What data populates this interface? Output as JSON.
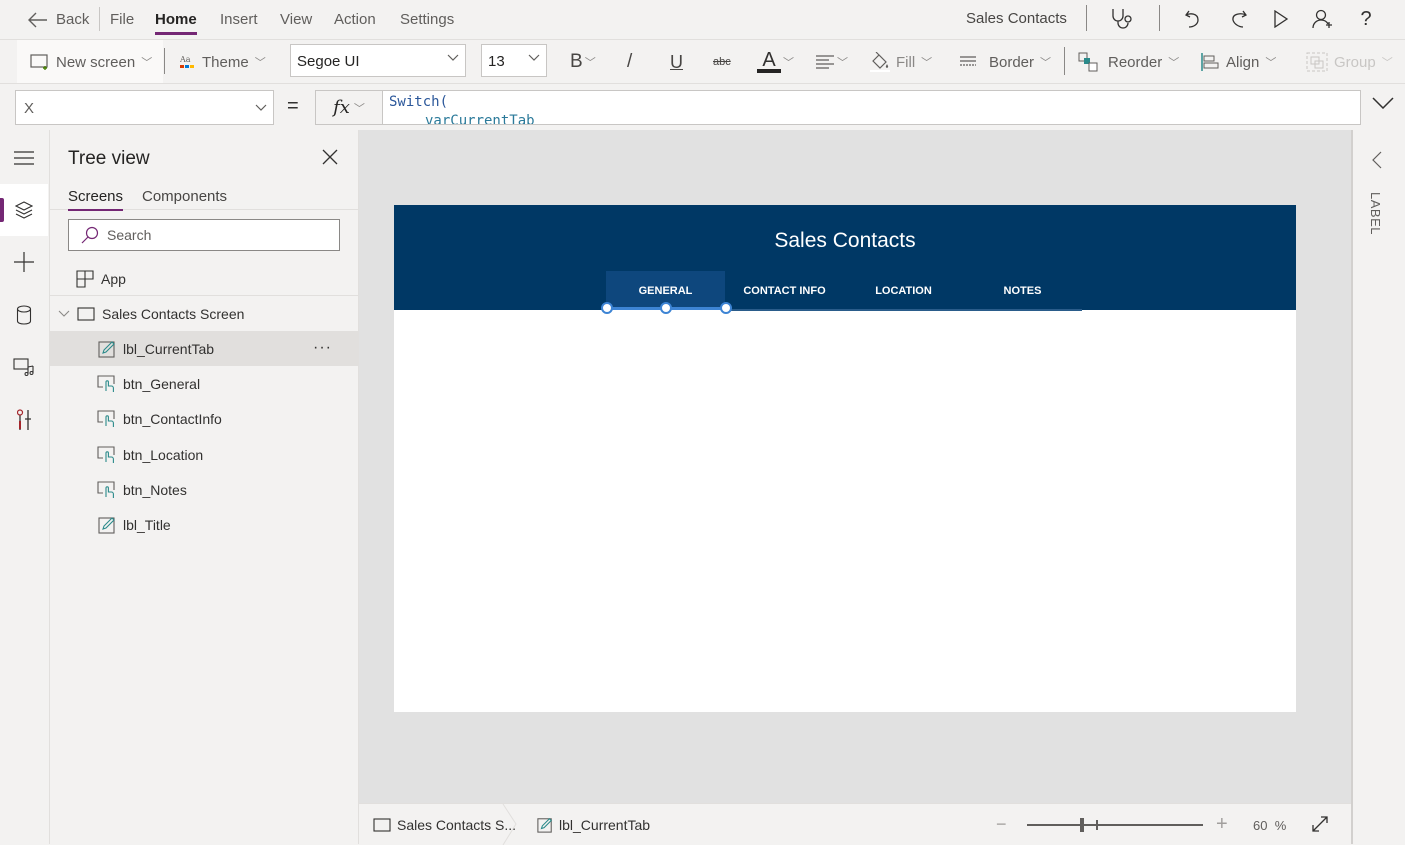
{
  "menubar": {
    "back_label": "Back",
    "items": [
      {
        "label": "File",
        "active": false
      },
      {
        "label": "Home",
        "active": true
      },
      {
        "label": "Insert",
        "active": false
      },
      {
        "label": "View",
        "active": false
      },
      {
        "label": "Action",
        "active": false
      },
      {
        "label": "Settings",
        "active": false
      }
    ],
    "app_name": "Sales Contacts",
    "icons": [
      "app-checker-icon",
      "undo-icon",
      "redo-icon",
      "play-icon",
      "share-user-icon",
      "help-icon"
    ]
  },
  "ribbon": {
    "new_screen": "New screen",
    "theme": "Theme",
    "font": "Segoe UI",
    "font_size": "13",
    "bold": "B",
    "italic": "/",
    "underline": "U",
    "strike": "abc",
    "font_color": "A",
    "fill": "Fill",
    "border": "Border",
    "reorder": "Reorder",
    "align": "Align",
    "group": "Group"
  },
  "formulabar": {
    "property": "X",
    "equals": "=",
    "fx": "fx",
    "formula_line1": "Switch(",
    "formula_line2": "varCurrentTab"
  },
  "tree": {
    "title": "Tree view",
    "tabs": [
      {
        "label": "Screens",
        "active": true
      },
      {
        "label": "Components",
        "active": false
      }
    ],
    "search_placeholder": "Search",
    "app_label": "App",
    "screen_label": "Sales Contacts Screen",
    "controls": [
      {
        "name": "lbl_CurrentTab",
        "type": "label",
        "selected": true
      },
      {
        "name": "btn_General",
        "type": "button",
        "selected": false
      },
      {
        "name": "btn_ContactInfo",
        "type": "button",
        "selected": false
      },
      {
        "name": "btn_Location",
        "type": "button",
        "selected": false
      },
      {
        "name": "btn_Notes",
        "type": "button",
        "selected": false
      },
      {
        "name": "lbl_Title",
        "type": "label",
        "selected": false
      }
    ],
    "more_label": "···"
  },
  "canvas": {
    "app_title": "Sales Contacts",
    "header_color": "#003865",
    "selected_tab_color": "#0e477d",
    "tabs": [
      {
        "label": "GENERAL",
        "selected": true
      },
      {
        "label": "CONTACT INFO",
        "selected": false
      },
      {
        "label": "LOCATION",
        "selected": false
      },
      {
        "label": "NOTES",
        "selected": false
      }
    ]
  },
  "statusbar": {
    "screen_crumb": "Sales Contacts S...",
    "control_crumb": "lbl_CurrentTab",
    "zoom_value": "60",
    "zoom_unit": "%",
    "zoom_minus": "−",
    "zoom_plus": "+"
  },
  "right_pane": {
    "label": "LABEL"
  },
  "accent_color": "#742774"
}
